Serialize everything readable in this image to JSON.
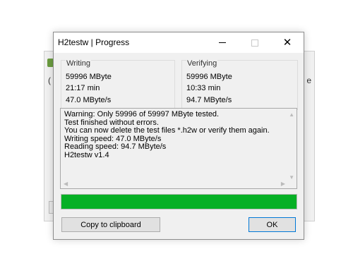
{
  "background_window": {
    "left_text": "(",
    "right_text": "e"
  },
  "dialog": {
    "title": "H2testw | Progress",
    "writing": {
      "label": "Writing",
      "size": "59996 MByte",
      "time": "21:17 min",
      "speed": "47.0 MByte/s"
    },
    "verifying": {
      "label": "Verifying",
      "size": "59996 MByte",
      "time": "10:33 min",
      "speed": "94.7 MByte/s"
    },
    "log_lines": [
      "Warning: Only 59996 of 59997 MByte tested.",
      "Test finished without errors.",
      "You can now delete the test files *.h2w or verify them again.",
      "Writing speed: 47.0 MByte/s",
      "Reading speed: 94.7 MByte/s",
      "H2testw v1.4"
    ],
    "progress_fraction": 1.0,
    "progress_color": "#06b025",
    "copy_button": "Copy to clipboard",
    "ok_button": "OK",
    "icons": {
      "minimize": "minimize-icon",
      "maximize": "maximize-icon",
      "close": "close-icon"
    }
  }
}
